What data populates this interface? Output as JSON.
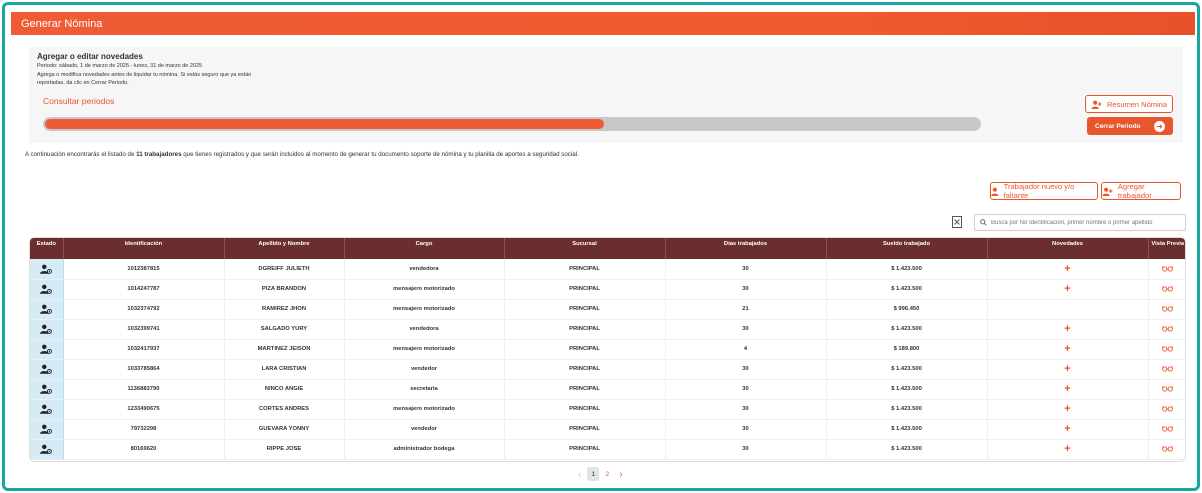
{
  "header": {
    "title": "Generar Nómina"
  },
  "period": {
    "title": "Agregar o editar novedades",
    "range": "Periodo: sábado, 1 de marzo de 2025 - lunes, 31 de marzo de 2025",
    "help": "Agrega o modifica novedades antes de liquidar tu nómina. Si estás seguro que ya están reportadas, da clic en Cerrar Periodo.",
    "consult_link": "Consultar periodos",
    "progress_percent": 60
  },
  "buttons": {
    "summary": "Resumen Nómina",
    "close_period": "Cerrar Periodo",
    "new_worker": "Trabajador nuevo y/o faltante",
    "add_worker": "Agregar trabajador"
  },
  "info": {
    "prefix": "A continuación encontrarás el listado de ",
    "count": "11 trabajadores",
    "suffix": " que tienes registrados y que serán incluidos al momento de generar tu documento soporte de nómina y tu planilla de aportes a seguridad social."
  },
  "search": {
    "placeholder": "Busca por No Identificación, primer nombre o primer apellido"
  },
  "table": {
    "columns": [
      "Estado",
      "Identificación",
      "Apellido y Nombre",
      "Cargo",
      "Sucursal",
      "Días trabajados",
      "Sueldo trabajado",
      "Novedades",
      "Vista Previa"
    ],
    "rows": [
      {
        "id": "1012387815",
        "name": "DGREIFF JULIETH",
        "cargo": "vendedora",
        "sucursal": "PRINCIPAL",
        "dias": "30",
        "sueldo": "$ 1.423.500",
        "novedad": true
      },
      {
        "id": "1014247787",
        "name": "PIZA BRANDON",
        "cargo": "mensajero motorizado",
        "sucursal": "PRINCIPAL",
        "dias": "30",
        "sueldo": "$ 1.423.500",
        "novedad": true
      },
      {
        "id": "1032374792",
        "name": "RAMIREZ JHON",
        "cargo": "mensajero motorizado",
        "sucursal": "PRINCIPAL",
        "dias": "21",
        "sueldo": "$ 996.450",
        "novedad": false
      },
      {
        "id": "1032399741",
        "name": "SALGADO YURY",
        "cargo": "vendedora",
        "sucursal": "PRINCIPAL",
        "dias": "30",
        "sueldo": "$ 1.423.500",
        "novedad": true
      },
      {
        "id": "1032417937",
        "name": "MARTINEZ JEISON",
        "cargo": "mensajero motorizado",
        "sucursal": "PRINCIPAL",
        "dias": "4",
        "sueldo": "$ 189.800",
        "novedad": true
      },
      {
        "id": "1033785864",
        "name": "LARA CRISTIAN",
        "cargo": "vendedor",
        "sucursal": "PRINCIPAL",
        "dias": "30",
        "sueldo": "$ 1.423.500",
        "novedad": true
      },
      {
        "id": "1136883790",
        "name": "NINCO ANGIE",
        "cargo": "secretaria",
        "sucursal": "PRINCIPAL",
        "dias": "30",
        "sueldo": "$ 1.423.500",
        "novedad": true
      },
      {
        "id": "1233490675",
        "name": "CORTES ANDRES",
        "cargo": "mensajero motorizado",
        "sucursal": "PRINCIPAL",
        "dias": "30",
        "sueldo": "$ 1.423.500",
        "novedad": true
      },
      {
        "id": "79732298",
        "name": "GUEVARA YONNY",
        "cargo": "vendedor",
        "sucursal": "PRINCIPAL",
        "dias": "30",
        "sueldo": "$ 1.423.500",
        "novedad": true
      },
      {
        "id": "80169620",
        "name": "RIPPE JOSE",
        "cargo": "administrador bodega",
        "sucursal": "PRINCIPAL",
        "dias": "30",
        "sueldo": "$ 1.423.500",
        "novedad": true
      }
    ]
  },
  "pagination": {
    "pages": [
      "1",
      "2"
    ],
    "current": "1"
  },
  "colors": {
    "accent": "#e8562c",
    "table_header": "#6b2e2e",
    "frame": "#17a6a0",
    "estado_bg": "#d5ecf7"
  }
}
